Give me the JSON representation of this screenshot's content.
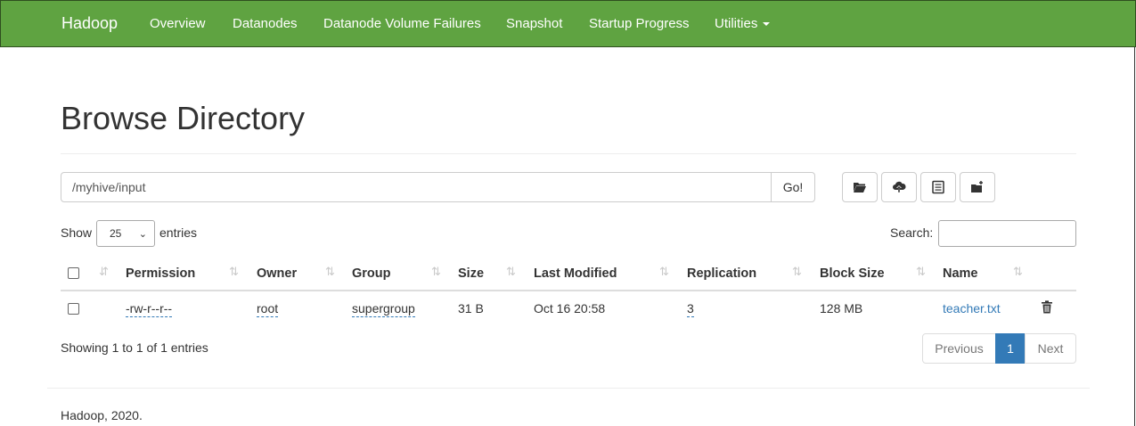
{
  "navbar": {
    "brand": "Hadoop",
    "items": [
      "Overview",
      "Datanodes",
      "Datanode Volume Failures",
      "Snapshot",
      "Startup Progress",
      "Utilities"
    ]
  },
  "page": {
    "title": "Browse Directory"
  },
  "path_bar": {
    "value": "/myhive/input",
    "go_label": "Go!"
  },
  "toolbar": {
    "icons": [
      "folder-open-icon",
      "cloud-upload-icon",
      "list-alt-icon",
      "folder-new-icon"
    ]
  },
  "table_controls": {
    "show_label": "Show",
    "entries_value": "25",
    "entries_label": "entries",
    "search_label": "Search:"
  },
  "table": {
    "columns": [
      "Permission",
      "Owner",
      "Group",
      "Size",
      "Last Modified",
      "Replication",
      "Block Size",
      "Name"
    ],
    "rows": [
      {
        "permission": "-rw-r--r--",
        "owner": "root",
        "group": "supergroup",
        "size": "31 B",
        "last_modified": "Oct 16 20:58",
        "replication": "3",
        "block_size": "128 MB",
        "name": "teacher.txt"
      }
    ]
  },
  "pagination": {
    "info": "Showing 1 to 1 of 1 entries",
    "previous": "Previous",
    "current": "1",
    "next": "Next"
  },
  "footer": {
    "text": "Hadoop, 2020."
  },
  "colors": {
    "navbar": "#5fa341",
    "link": "#337ab7",
    "active_page": "#337ab7"
  }
}
